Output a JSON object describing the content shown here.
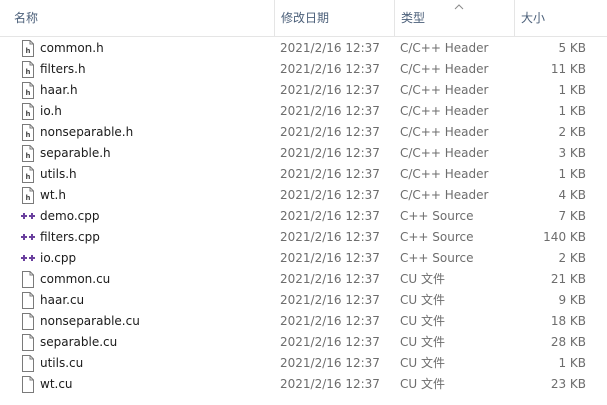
{
  "columns": {
    "name": "名称",
    "date_modified": "修改日期",
    "type": "类型",
    "size": "大小"
  },
  "files": [
    {
      "name": "common.h",
      "date": "2021/2/16 12:37",
      "type": "C/C++ Header",
      "size": "5 KB",
      "icon": "header-file-icon"
    },
    {
      "name": "filters.h",
      "date": "2021/2/16 12:37",
      "type": "C/C++ Header",
      "size": "11 KB",
      "icon": "header-file-icon"
    },
    {
      "name": "haar.h",
      "date": "2021/2/16 12:37",
      "type": "C/C++ Header",
      "size": "1 KB",
      "icon": "header-file-icon"
    },
    {
      "name": "io.h",
      "date": "2021/2/16 12:37",
      "type": "C/C++ Header",
      "size": "1 KB",
      "icon": "header-file-icon"
    },
    {
      "name": "nonseparable.h",
      "date": "2021/2/16 12:37",
      "type": "C/C++ Header",
      "size": "2 KB",
      "icon": "header-file-icon"
    },
    {
      "name": "separable.h",
      "date": "2021/2/16 12:37",
      "type": "C/C++ Header",
      "size": "3 KB",
      "icon": "header-file-icon"
    },
    {
      "name": "utils.h",
      "date": "2021/2/16 12:37",
      "type": "C/C++ Header",
      "size": "1 KB",
      "icon": "header-file-icon"
    },
    {
      "name": "wt.h",
      "date": "2021/2/16 12:37",
      "type": "C/C++ Header",
      "size": "4 KB",
      "icon": "header-file-icon"
    },
    {
      "name": "demo.cpp",
      "date": "2021/2/16 12:37",
      "type": "C++ Source",
      "size": "7 KB",
      "icon": "cpp-source-icon"
    },
    {
      "name": "filters.cpp",
      "date": "2021/2/16 12:37",
      "type": "C++ Source",
      "size": "140 KB",
      "icon": "cpp-source-icon"
    },
    {
      "name": "io.cpp",
      "date": "2021/2/16 12:37",
      "type": "C++ Source",
      "size": "2 KB",
      "icon": "cpp-source-icon"
    },
    {
      "name": "common.cu",
      "date": "2021/2/16 12:37",
      "type": "CU 文件",
      "size": "21 KB",
      "icon": "generic-file-icon"
    },
    {
      "name": "haar.cu",
      "date": "2021/2/16 12:37",
      "type": "CU 文件",
      "size": "9 KB",
      "icon": "generic-file-icon"
    },
    {
      "name": "nonseparable.cu",
      "date": "2021/2/16 12:37",
      "type": "CU 文件",
      "size": "18 KB",
      "icon": "generic-file-icon"
    },
    {
      "name": "separable.cu",
      "date": "2021/2/16 12:37",
      "type": "CU 文件",
      "size": "28 KB",
      "icon": "generic-file-icon"
    },
    {
      "name": "utils.cu",
      "date": "2021/2/16 12:37",
      "type": "CU 文件",
      "size": "1 KB",
      "icon": "generic-file-icon"
    },
    {
      "name": "wt.cu",
      "date": "2021/2/16 12:37",
      "type": "CU 文件",
      "size": "23 KB",
      "icon": "generic-file-icon"
    }
  ],
  "colors": {
    "header_text": "#4c607a",
    "name_text": "#1a1a1a",
    "meta_text": "#6d6d6d",
    "cpp_icon_accent": "#6a3f9e"
  }
}
